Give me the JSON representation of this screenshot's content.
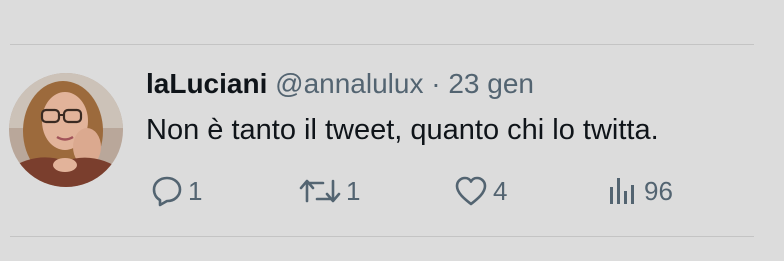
{
  "tweet": {
    "author_name": "laLuciani",
    "handle": "@annalulux",
    "separator": "·",
    "date": "23 gen",
    "text": "Non è tanto il tweet, quanto chi lo twitta.",
    "avatar_alt": "avatar"
  },
  "actions": {
    "reply": {
      "icon": "reply-icon",
      "count": "1"
    },
    "retweet": {
      "icon": "retweet-icon",
      "count": "1"
    },
    "like": {
      "icon": "heart-icon",
      "count": "4"
    },
    "views": {
      "icon": "views-bar-chart-icon",
      "count": "96"
    }
  },
  "colors": {
    "background": "#dcdcdc",
    "text_primary": "#0f1419",
    "text_secondary": "#536471",
    "divider": "#c4c4c4"
  }
}
